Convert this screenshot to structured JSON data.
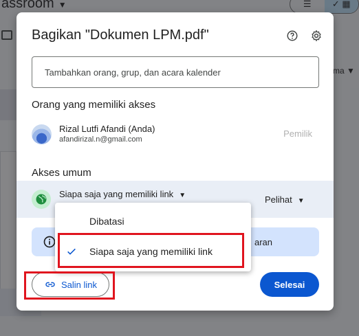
{
  "background": {
    "app_title": "assroom",
    "sort_label": "ma"
  },
  "dialog": {
    "title": "Bagikan \"Dokumen LPM.pdf\"",
    "add_people_placeholder": "Tambahkan orang, grup, dan acara kalender",
    "access_heading": "Orang yang memiliki akses",
    "person": {
      "name": "Rizal Lutfi Afandi (Anda)",
      "email": "afandirizal.n@gmail.com",
      "role": "Pemilik"
    },
    "general_access_heading": "Akses umum",
    "general_access_setting": "Siapa saja yang memiliki link",
    "general_access_role": "Pelihat",
    "info_text_visible": "aran",
    "copy_link_label": "Salin link",
    "done_label": "Selesai"
  },
  "menu": {
    "options": [
      {
        "label": "Dibatasi",
        "selected": false
      },
      {
        "label": "Siapa saja yang memiliki link",
        "selected": true
      }
    ]
  },
  "colors": {
    "primary": "#0b57d0",
    "highlight": "#e0141e",
    "general_row_bg": "#e9eef6",
    "globe_bg": "#c4eed0",
    "info_bg": "#d3e3fd"
  },
  "icons": {
    "help": "help-circle-icon",
    "settings": "gear-icon",
    "globe": "globe-icon",
    "info": "info-icon",
    "link": "link-icon",
    "check": "check-icon"
  }
}
